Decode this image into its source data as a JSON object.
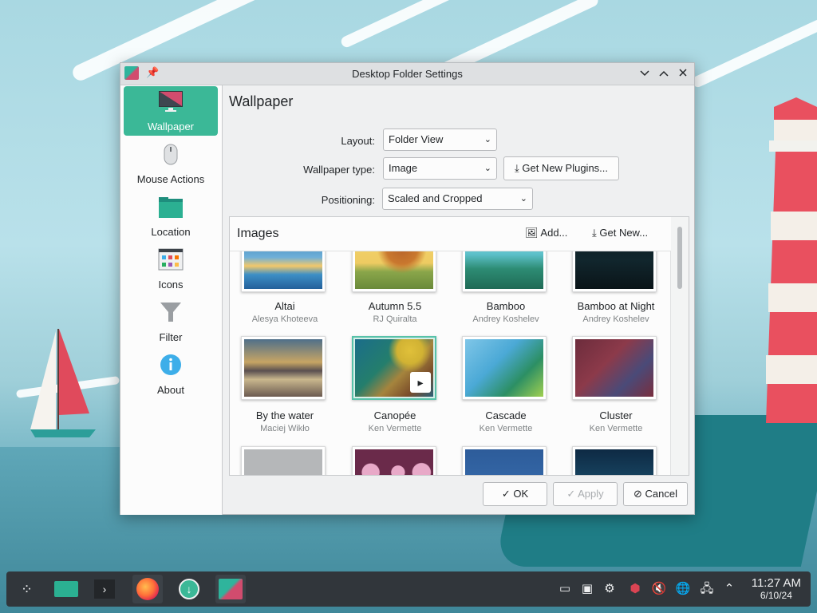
{
  "window": {
    "title": "Desktop Folder Settings",
    "pin_icon": "pin-icon",
    "minimize_icon": "chevron-down-icon",
    "maximize_icon": "chevron-up-icon",
    "close_icon": "close-icon"
  },
  "sidebar": {
    "items": [
      {
        "label": "Wallpaper",
        "icon": "wallpaper-icon",
        "active": true
      },
      {
        "label": "Mouse Actions",
        "icon": "mouse-icon"
      },
      {
        "label": "Location",
        "icon": "folder-icon"
      },
      {
        "label": "Icons",
        "icon": "icons-icon"
      },
      {
        "label": "Filter",
        "icon": "filter-icon"
      },
      {
        "label": "About",
        "icon": "info-icon"
      }
    ]
  },
  "page": {
    "heading": "Wallpaper"
  },
  "form": {
    "layout_label": "Layout:",
    "layout_value": "Folder View",
    "wallpaper_type_label": "Wallpaper type:",
    "wallpaper_type_value": "Image",
    "get_new_plugins_label": "Get New Plugins...",
    "positioning_label": "Positioning:",
    "positioning_value": "Scaled and Cropped"
  },
  "images": {
    "title": "Images",
    "add_label": "Add...",
    "get_new_label": "Get New...",
    "items": [
      {
        "name": "Altai",
        "author": "Alesya Khoteeva"
      },
      {
        "name": "Autumn 5.5",
        "author": "RJ Quiralta"
      },
      {
        "name": "Bamboo",
        "author": "Andrey Koshelev"
      },
      {
        "name": "Bamboo at Night",
        "author": "Andrey Koshelev"
      },
      {
        "name": "By the water",
        "author": "Maciej Wikło"
      },
      {
        "name": "Canopée",
        "author": "Ken Vermette",
        "selected": true
      },
      {
        "name": "Cascade",
        "author": "Ken Vermette"
      },
      {
        "name": "Cluster",
        "author": "Ken Vermette"
      }
    ]
  },
  "footer": {
    "ok_label": "OK",
    "apply_label": "Apply",
    "cancel_label": "Cancel"
  },
  "taskbar": {
    "time": "11:27 AM",
    "date": "6/10/24",
    "apps": [
      "app-launcher-icon",
      "file-manager-icon",
      "terminal-icon",
      "firefox-icon",
      "discover-icon",
      "system-settings-icon"
    ]
  },
  "colors": {
    "accent": "#3bb897",
    "taskbar": "#31363b",
    "dialog_bg": "#eff0f1"
  }
}
